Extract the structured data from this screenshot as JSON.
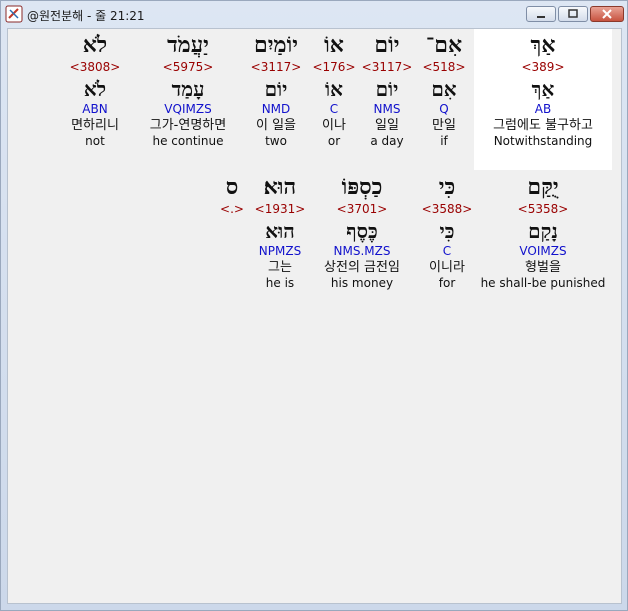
{
  "window": {
    "title": "@원전분해 - 줄 21:21",
    "icon": "bible-app-icon"
  },
  "rows": [
    {
      "words": [
        {
          "heb": "אַךְ",
          "strong": "<389>",
          "lemma": "אַךְ",
          "morph": "AB",
          "kor": "그럼에도 불구하고",
          "eng": "Notwithstanding",
          "highlight": true
        },
        {
          "heb": "אִם־",
          "strong": "<518>",
          "lemma": "אִם",
          "morph": "Q",
          "kor": "만일",
          "eng": "if"
        },
        {
          "heb": "יוֹם",
          "strong": "<3117>",
          "lemma": "יוֹם",
          "morph": "NMS",
          "kor": "일일",
          "eng": "a day"
        },
        {
          "heb": "אוֹ",
          "strong": "<176>",
          "lemma": "אוֹ",
          "morph": "C",
          "kor": "이나",
          "eng": "or"
        },
        {
          "heb": "יוֹמַיִם",
          "strong": "<3117>",
          "lemma": "יוֹם",
          "morph": "NMD",
          "kor": "이 일을",
          "eng": "two"
        },
        {
          "heb": "יַעֲמֹד",
          "strong": "<5975>",
          "lemma": "עָמַד",
          "morph": "VQIMZS",
          "kor": "그가-연명하면",
          "eng": "he continue"
        },
        {
          "heb": "לֹא",
          "strong": "<3808>",
          "lemma": "לֹא",
          "morph": "ABN",
          "kor": "면하리니",
          "eng": "not"
        }
      ]
    },
    {
      "words": [
        {
          "heb": "יֻקַּם",
          "strong": "<5358>",
          "lemma": "נָקַם",
          "morph": "VOIMZS",
          "kor": "형벌을",
          "eng": "he shall-be punished"
        },
        {
          "heb": "כִּי",
          "strong": "<3588>",
          "lemma": "כִּי",
          "morph": "C",
          "kor": "이니라",
          "eng": "for"
        },
        {
          "heb": "כַסְפּוֹ",
          "strong": "<3701>",
          "lemma": "כֶּסֶף",
          "morph": "NMS.MZS",
          "kor": "상전의 금전임",
          "eng": "his money"
        },
        {
          "heb": "הוּא׃",
          "strong": "<1931>",
          "lemma": "הוּא",
          "morph": "NPMZS",
          "kor": "그는",
          "eng": "he is"
        },
        {
          "heb": "ס",
          "strong": "<.>",
          "lemma": "",
          "morph": "",
          "kor": "",
          "eng": ""
        }
      ]
    }
  ]
}
